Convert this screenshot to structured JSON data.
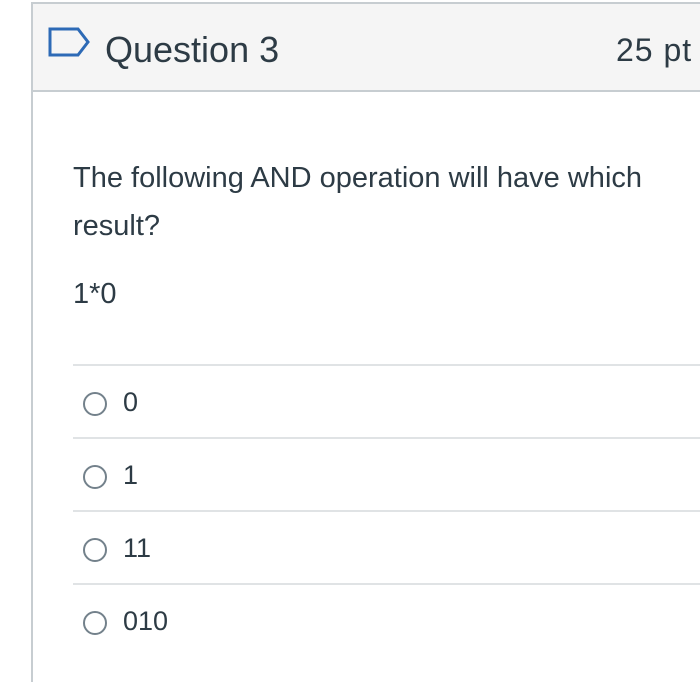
{
  "question": {
    "title": "Question 3",
    "points": "25 pt",
    "text": "The following AND operation will have which result?",
    "expression": "1*0",
    "flag_icon": "flag-outline-icon"
  },
  "answers": [
    {
      "label": "0"
    },
    {
      "label": "1"
    },
    {
      "label": "11"
    },
    {
      "label": "010"
    }
  ],
  "colors": {
    "header_bg": "#f5f5f5",
    "border": "#c7cdd1",
    "text": "#2d3b45",
    "flag": "#2d6ab6"
  }
}
